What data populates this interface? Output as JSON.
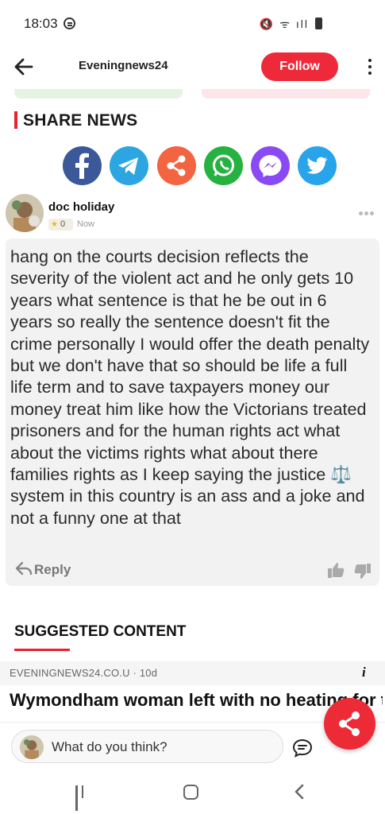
{
  "status_bar": {
    "time": "18:03",
    "icons": "🔇 ᯤ ıll"
  },
  "header": {
    "title": "Eveningnews24",
    "follow_label": "Follow"
  },
  "share": {
    "title": "SHARE NEWS",
    "buttons": [
      {
        "name": "facebook",
        "color": "#3b5998"
      },
      {
        "name": "telegram",
        "color": "#2ca5e0"
      },
      {
        "name": "share",
        "color": "#f26540"
      },
      {
        "name": "whatsapp",
        "color": "#25b240"
      },
      {
        "name": "messenger",
        "color": "#8a4af3"
      },
      {
        "name": "twitter",
        "color": "#27a4ea"
      }
    ]
  },
  "comment": {
    "user": "doc holiday",
    "rating": "0",
    "time": "Now",
    "text": "hang on the courts decision reflects the severity of the violent act and he only gets 10 years what sentence is that he be out in 6 years so really the sentence doesn't fit the crime personally I would offer the death penalty but we don't have that so should be life a full life term and to save taxpayers money our money treat him like how the Victorians treated prisoners and for the human rights act what about the victims rights what about there families rights as I keep saying the justice ⚖️ system in this country is an ass and a joke and not a funny one at that",
    "reply_label": "Reply"
  },
  "suggested": {
    "title": "SUGGESTED CONTENT",
    "source": "EVENINGNEWS24.CO.U",
    "age": "10d",
    "info": "i",
    "article_title": "Wymondham woman left with no heating for two weeks"
  },
  "input": {
    "placeholder": "What do you think?"
  },
  "colors": {
    "accent": "#ee2a3a",
    "comment_bg": "#f2f2f2"
  }
}
